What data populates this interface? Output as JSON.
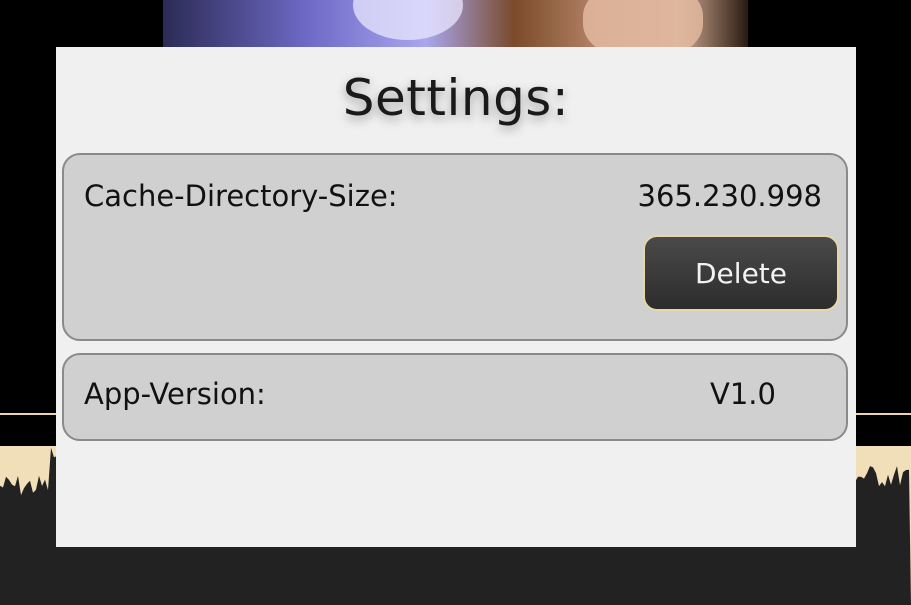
{
  "settings": {
    "title": "Settings:",
    "cache": {
      "label": "Cache-Directory-Size:",
      "value": "365.230.998",
      "delete_label": "Delete"
    },
    "version": {
      "label": "App-Version:",
      "value": "V1.0"
    }
  },
  "colors": {
    "panel_background": "#f0f0f0",
    "card_background": "#d0d0d0",
    "button_background": "#333333",
    "button_border": "#e8d6a8",
    "waveform_background": "#f1dfba",
    "waveform_fill": "#222222"
  }
}
